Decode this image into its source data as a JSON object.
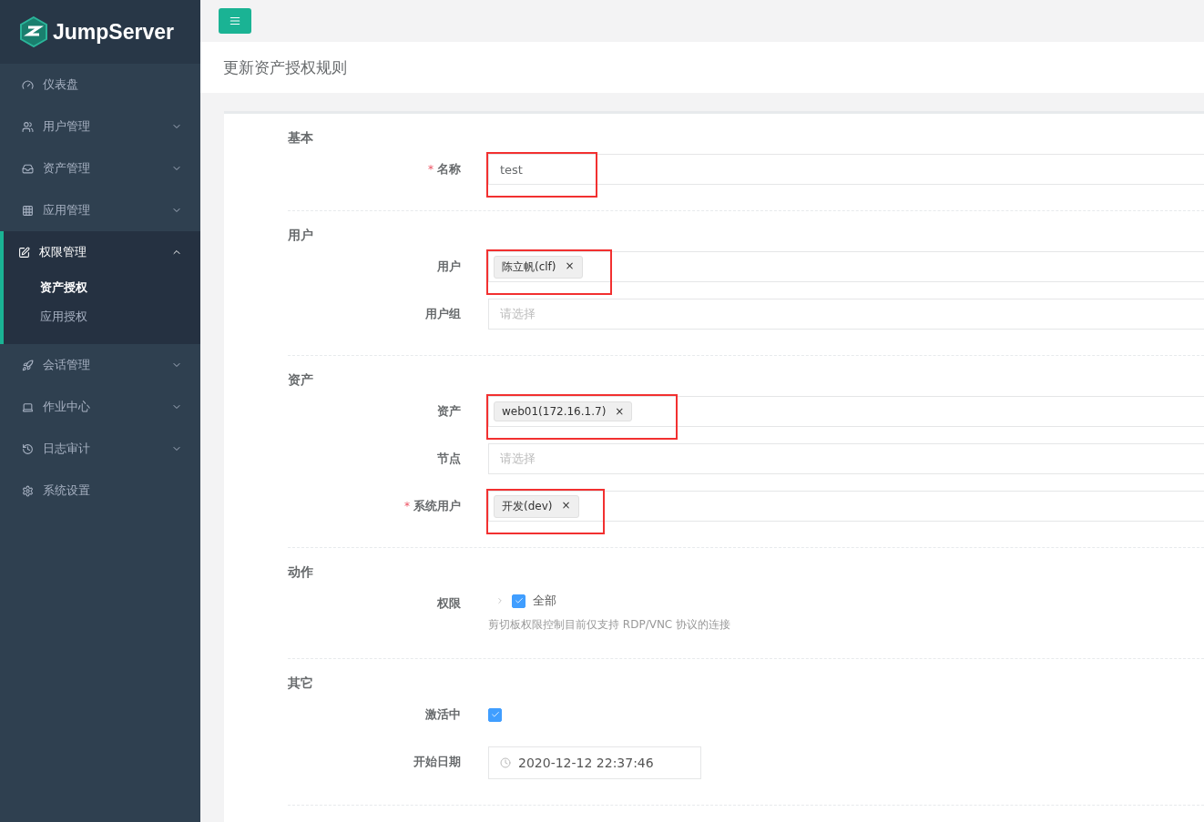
{
  "brand": {
    "name": "JumpServer"
  },
  "sidebar": {
    "items": [
      {
        "label": "仪表盘",
        "expandable": false,
        "expanded": false
      },
      {
        "label": "用户管理",
        "expandable": true,
        "expanded": false
      },
      {
        "label": "资产管理",
        "expandable": true,
        "expanded": false
      },
      {
        "label": "应用管理",
        "expandable": true,
        "expanded": false
      },
      {
        "label": "权限管理",
        "expandable": true,
        "expanded": true,
        "children": [
          {
            "label": "资产授权",
            "selected": true
          },
          {
            "label": "应用授权",
            "selected": false
          }
        ]
      },
      {
        "label": "会话管理",
        "expandable": true,
        "expanded": false
      },
      {
        "label": "作业中心",
        "expandable": true,
        "expanded": false
      },
      {
        "label": "日志审计",
        "expandable": true,
        "expanded": false
      },
      {
        "label": "系统设置",
        "expandable": false,
        "expanded": false
      }
    ]
  },
  "page_title": "更新资产授权规则",
  "sections": [
    {
      "title": "基本",
      "fields": [
        {
          "kind": "text",
          "label": "名称",
          "required_mark": "*",
          "value": "test",
          "highlighted": true
        }
      ]
    },
    {
      "title": "用户",
      "fields": [
        {
          "kind": "select",
          "label": "用户",
          "tags": [
            {
              "label": "陈立帆(clf)",
              "remove": "×"
            }
          ],
          "highlighted": true
        },
        {
          "kind": "select",
          "label": "用户组",
          "placeholder": "请选择",
          "highlighted": false
        }
      ]
    },
    {
      "title": "资产",
      "fields": [
        {
          "kind": "select",
          "label": "资产",
          "tags": [
            {
              "label": "web01(172.16.1.7)",
              "remove": "×"
            }
          ],
          "highlighted": true
        },
        {
          "kind": "select",
          "label": "节点",
          "placeholder": "请选择",
          "highlighted": false
        },
        {
          "kind": "select",
          "label": "系统用户",
          "required_mark": "*",
          "tags": [
            {
              "label": "开发(dev)",
              "remove": "×"
            }
          ],
          "highlighted": true
        }
      ]
    },
    {
      "title": "动作",
      "fields": [
        {
          "kind": "tree",
          "label": "权限",
          "option": "全部",
          "checked": true,
          "help": "剪切板权限控制目前仅支持 RDP/VNC 协议的连接",
          "highlighted": false
        }
      ]
    },
    {
      "title": "其它",
      "fields": [
        {
          "kind": "checkbox",
          "label": "激活中",
          "checked": true,
          "highlighted": false
        },
        {
          "kind": "date",
          "label": "开始日期",
          "value": "2020-12-12 22:37:46",
          "highlighted": false
        }
      ]
    }
  ]
}
